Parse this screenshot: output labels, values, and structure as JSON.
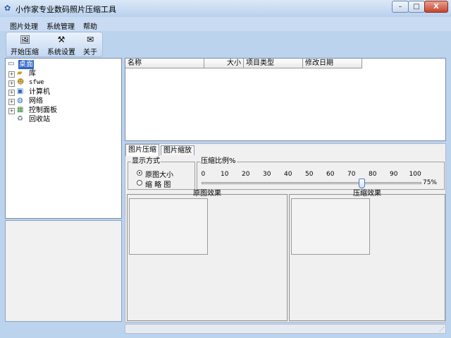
{
  "window": {
    "title": "小作家专业数码照片压缩工具",
    "icon": "app-icon",
    "controls": {
      "minimize": "–",
      "maximize": "□",
      "close": "X"
    }
  },
  "menu": [
    "图片处理",
    "系统管理",
    "帮助"
  ],
  "toolbar": {
    "items": [
      {
        "label": "开始压缩",
        "icon": "compress-icon"
      },
      {
        "label": "系统设置",
        "icon": "settings-icon"
      },
      {
        "label": "关于",
        "icon": "about-icon"
      }
    ]
  },
  "tree": {
    "root": "桌面",
    "items": [
      "库",
      "sfwe",
      "计算机",
      "网络",
      "控制面板",
      "回收站"
    ]
  },
  "file_list": {
    "columns": [
      "名称",
      "大小",
      "项目类型",
      "修改日期"
    ]
  },
  "tabs": [
    "图片压缩",
    "图片缩放"
  ],
  "display_mode": {
    "title": "显示方式",
    "options": [
      "原图大小",
      "缩 略 图"
    ],
    "selected": 0
  },
  "compression": {
    "title": "压缩比例%",
    "ticks": [
      "0",
      "10",
      "20",
      "30",
      "40",
      "50",
      "60",
      "70",
      "80",
      "90",
      "100"
    ],
    "value": 75,
    "value_label": "75%"
  },
  "previews": {
    "original_title": "原图效果",
    "compressed_title": "压缩效果"
  },
  "colors": {
    "selection": "#3166c5",
    "chrome": "#bcd3ee"
  }
}
